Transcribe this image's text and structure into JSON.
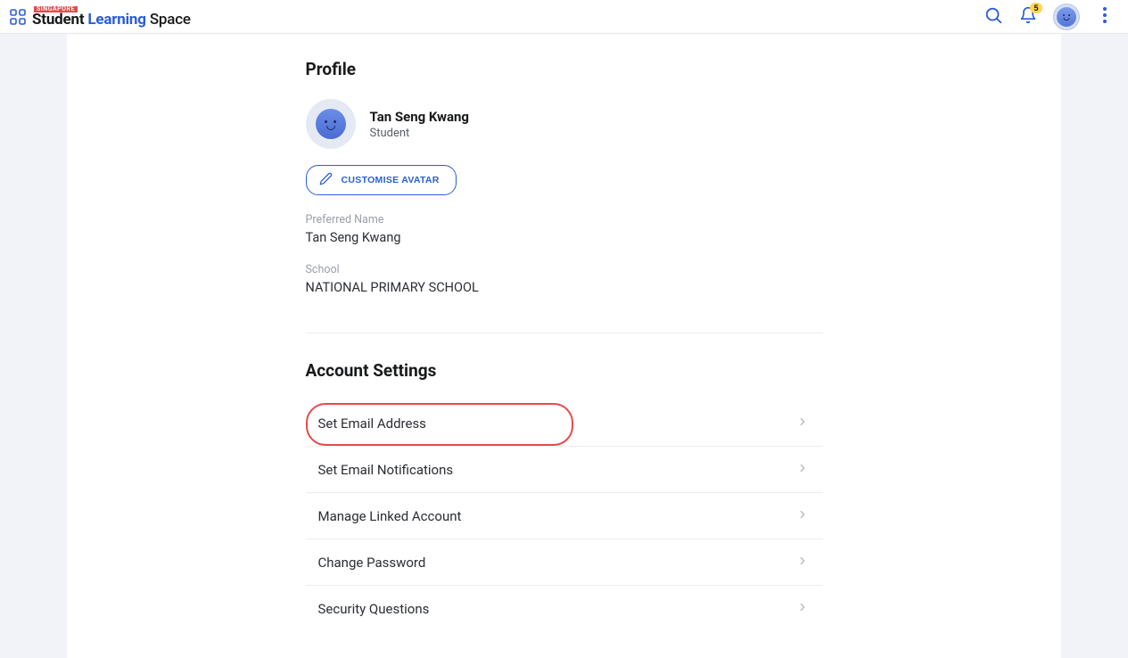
{
  "header": {
    "singapore_tag": "SINGAPORE",
    "brand_student": "Student",
    "brand_learning": "Learning",
    "brand_space": "Space",
    "notification_count": "5"
  },
  "profile": {
    "section_title": "Profile",
    "name": "Tan Seng Kwang",
    "role": "Student",
    "customise_label": "CUSTOMISE AVATAR",
    "preferred_name_label": "Preferred Name",
    "preferred_name_value": "Tan Seng Kwang",
    "school_label": "School",
    "school_value": "NATIONAL PRIMARY SCHOOL"
  },
  "account": {
    "section_title": "Account Settings",
    "items": [
      {
        "label": "Set Email Address"
      },
      {
        "label": "Set Email Notifications"
      },
      {
        "label": "Manage Linked Account"
      },
      {
        "label": "Change Password"
      },
      {
        "label": "Security Questions"
      }
    ]
  }
}
